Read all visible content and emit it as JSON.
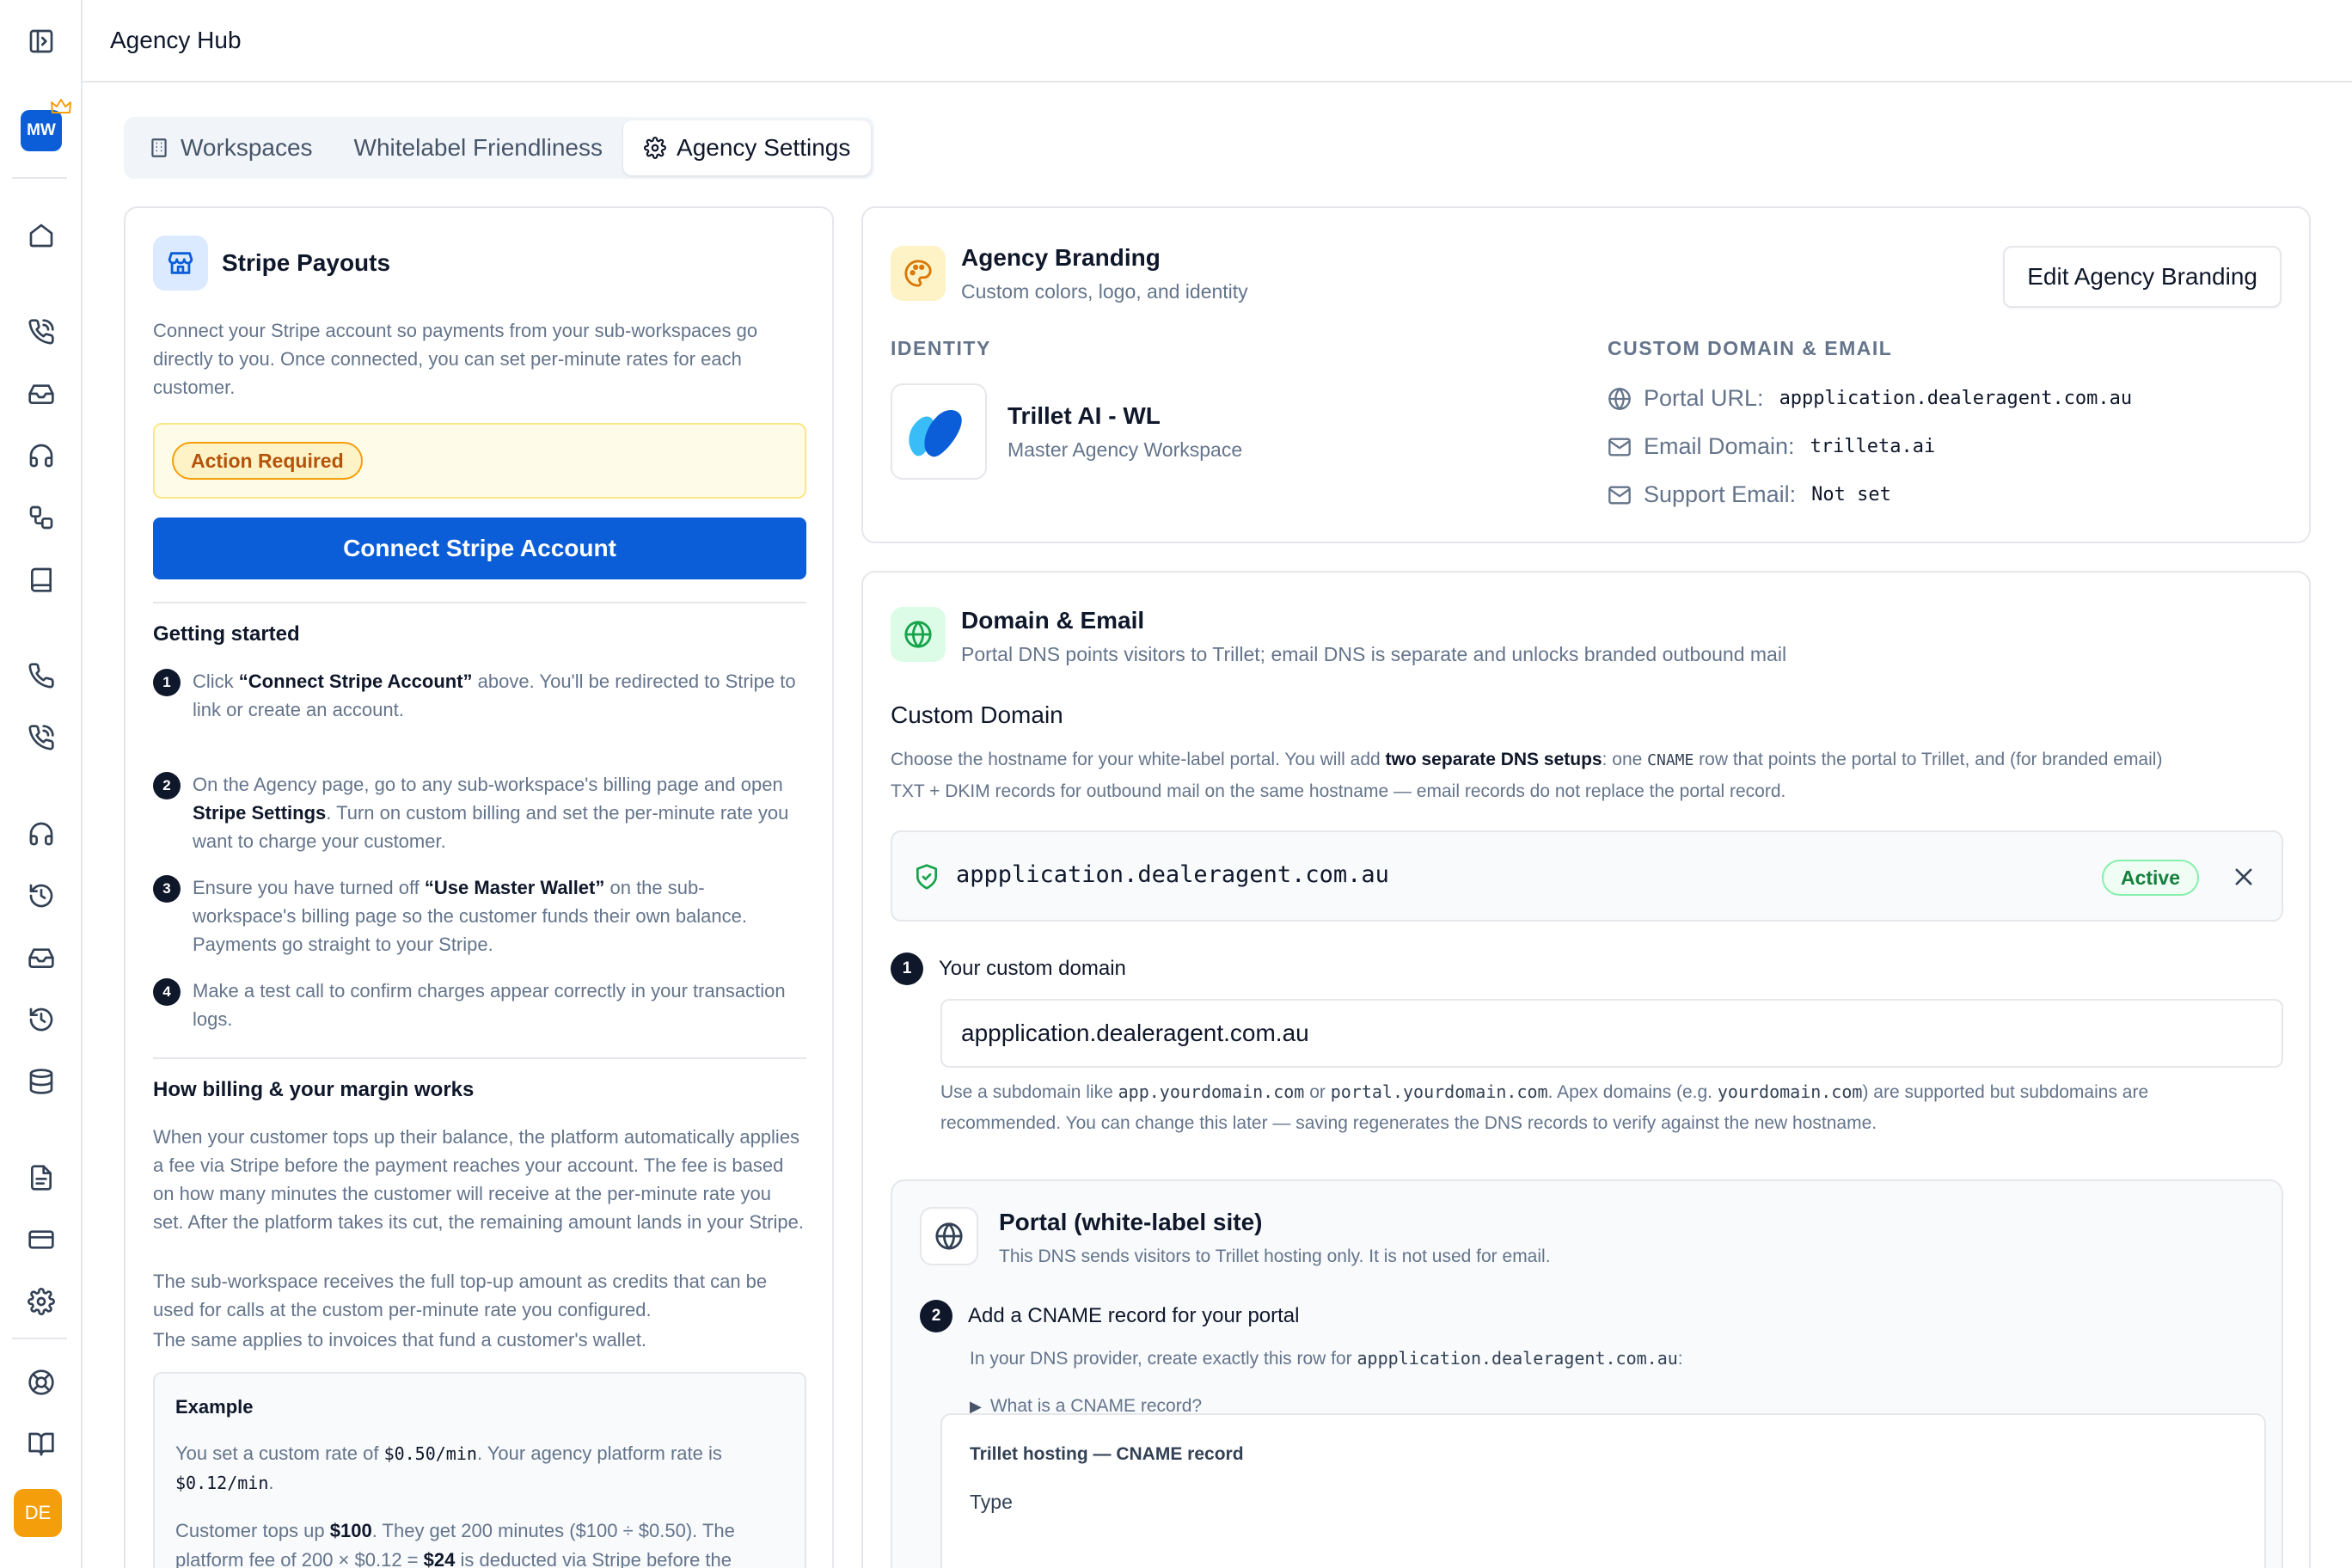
{
  "app": {
    "title": "Agency Hub"
  },
  "sidebar": {
    "workspace_badge": "MW",
    "user_badge": "DE"
  },
  "tabs": [
    {
      "label": "Workspaces",
      "icon": "building-icon"
    },
    {
      "label": "Whitelabel Friendliness"
    },
    {
      "label": "Agency Settings",
      "icon": "gear-icon",
      "active": true
    }
  ],
  "stripe": {
    "title": "Stripe Payouts",
    "description": "Connect your Stripe account so payments from your sub-workspaces go directly to you. Once connected, you can set per-minute rates for each customer.",
    "status_badge": "Action Required",
    "connect_label": "Connect Stripe Account",
    "getting_started_title": "Getting started",
    "steps": [
      {
        "num": "1",
        "pre": "Click ",
        "bold": "“Connect Stripe Account”",
        "post": " above. You'll be redirected to Stripe to link or create an account."
      },
      {
        "num": "2",
        "pre": "On the Agency page, go to any sub-workspace's billing page and open ",
        "bold": "Stripe Settings",
        "post": ". Turn on custom billing and set the per-minute rate you want to charge your customer."
      },
      {
        "num": "3",
        "pre": "Ensure you have turned off ",
        "bold": "“Use Master Wallet”",
        "post": " on the sub-workspace's billing page so the customer funds their own balance. Payments go straight to your Stripe."
      },
      {
        "num": "4",
        "pre": "Make a test call to confirm charges appear correctly in your transaction logs.",
        "bold": "",
        "post": ""
      }
    ],
    "billing_title": "How billing & your margin works",
    "billing_p1": "When your customer tops up their balance, the platform automatically applies a fee via Stripe before the payment reaches your account. The fee is based on how many minutes the customer will receive at the per-minute rate you set. After the platform takes its cut, the remaining amount lands in your Stripe.",
    "billing_p2": "The sub-workspace receives the full top-up amount as credits that can be used for calls at the custom per-minute rate you configured.",
    "billing_p3": "The same applies to invoices that fund a customer's wallet.",
    "example": {
      "title": "Example",
      "l1_pre": "You set a custom rate of ",
      "l1_code": "$0.50/min",
      "l1_mid": ". Your agency platform rate is ",
      "l1_code2": "$0.12/min",
      "l1_post": ".",
      "l2_pre": "Customer tops up ",
      "l2_bold": "$100",
      "l2_mid": ". They get 200 minutes ($100 ÷ $0.50). The platform fee of 200 × $0.12 = ",
      "l2_bold2": "$24",
      "l2_post": " is deducted via Stripe before the"
    }
  },
  "branding": {
    "title": "Agency Branding",
    "subtitle": "Custom colors, logo, and identity",
    "edit_label": "Edit Agency Branding",
    "identity_heading": "IDENTITY",
    "agency_name": "Trillet AI - WL",
    "agency_type": "Master Agency Workspace",
    "domain_heading": "CUSTOM DOMAIN & EMAIL",
    "portal_url_label": "Portal URL:",
    "portal_url_value": "appplication.dealeragent.com.au",
    "email_domain_label": "Email Domain:",
    "email_domain_value": "trilleta.ai",
    "support_email_label": "Support Email:",
    "support_email_value": "Not set"
  },
  "domain": {
    "title": "Domain & Email",
    "subtitle": "Portal DNS points visitors to Trillet; email DNS is separate and unlocks branded outbound mail",
    "custom_domain_title": "Custom Domain",
    "desc_pre": "Choose the hostname for your white-label portal. You will add ",
    "desc_bold": "two separate DNS setups",
    "desc_mid": ": one ",
    "desc_code": "CNAME",
    "desc_post": " row that points the portal to Trillet, and (for branded email)",
    "desc_line2": "TXT + DKIM records for outbound mail on the same hostname — email records do not replace the portal record.",
    "current_domain": "appplication.dealeragent.com.au",
    "status": "Active",
    "step1_num": "1",
    "step1_label": "Your custom domain",
    "input_value": "appplication.dealeragent.com.au",
    "hint_pre": "Use a subdomain like ",
    "hint_code1": "app.yourdomain.com",
    "hint_or": " or ",
    "hint_code2": "portal.yourdomain.com",
    "hint_mid": ". Apex domains (e.g. ",
    "hint_code3": "yourdomain.com",
    "hint_post": ") are supported but subdomains are",
    "hint_line2": "recommended. You can change this later — saving regenerates the DNS records to verify against the new hostname.",
    "portal_title": "Portal (white-label site)",
    "portal_subtitle": "This DNS sends visitors to Trillet hosting only. It is not used for email.",
    "step2_num": "2",
    "step2_label": "Add a CNAME record for your portal",
    "step2_desc_pre": "In your DNS provider, create exactly this row for ",
    "step2_desc_code": "appplication.dealeragent.com.au",
    "step2_desc_post": ":",
    "cname_toggle": "What is a CNAME record?",
    "record_title": "Trillet hosting — CNAME record",
    "record_type_label": "Type"
  },
  "colors": {
    "primary": "#0b5ed7",
    "success": "#15803d",
    "warning": "#b45309"
  }
}
